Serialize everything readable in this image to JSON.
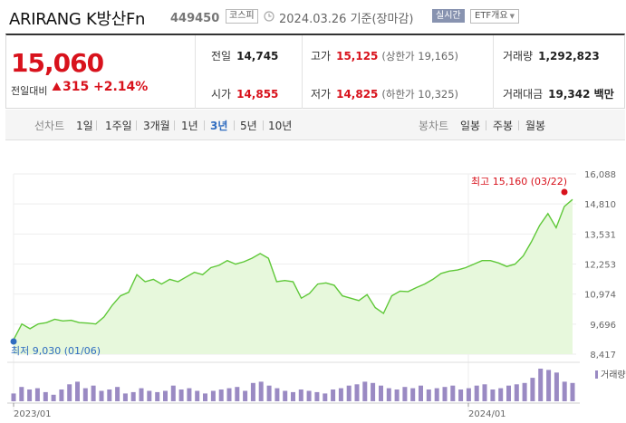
{
  "header": {
    "name": "ARIRANG K방산Fn",
    "code": "449450",
    "market_badge": "코스피",
    "date": "2024.03.26 기준(장마감)",
    "realtime_badge": "실시간",
    "etf_badge": "ETF개요"
  },
  "quote": {
    "price": "15,060",
    "change_label": "전일대비",
    "change": "315",
    "change_pct": "+2.14%",
    "prev_label": "전일",
    "prev": "14,745",
    "high_label": "고가",
    "high": "15,125",
    "upper_limit": "(상한가 19,165)",
    "volume_label": "거래량",
    "volume": "1,292,823",
    "open_label": "시가",
    "open": "14,855",
    "low_label": "저가",
    "low": "14,825",
    "lower_limit": "(하한가 10,325)",
    "amount_label": "거래대금",
    "amount": "19,342 백만"
  },
  "tabs": {
    "line_label": "선차트",
    "line": [
      "1일",
      "1주일",
      "3개월",
      "1년",
      "3년",
      "5년",
      "10년"
    ],
    "active": "3년",
    "candle_label": "봉차트",
    "candle": [
      "일봉",
      "주봉",
      "월봉"
    ]
  },
  "colors": {
    "up": "#d8121c",
    "line": "#5fc838",
    "fill": "#e7f8dc",
    "volume": "#9a8ac3",
    "low": "#2f6cc0",
    "high": "#d8121c"
  },
  "chart_data": {
    "type": "area",
    "price_series": [
      9030,
      9700,
      9500,
      9700,
      9760,
      9900,
      9830,
      9860,
      9760,
      9740,
      9700,
      10000,
      10500,
      10900,
      11050,
      11800,
      11500,
      11600,
      11400,
      11600,
      11500,
      11700,
      11900,
      11800,
      12100,
      12200,
      12400,
      12250,
      12350,
      12500,
      12700,
      12500,
      11500,
      11550,
      11500,
      10800,
      11000,
      11400,
      11450,
      11350,
      10900,
      10800,
      10700,
      10950,
      10400,
      10150,
      10900,
      11100,
      11080,
      11250,
      11400,
      11600,
      11850,
      11950,
      12000,
      12100,
      12250,
      12400,
      12400,
      12300,
      12150,
      12250,
      12600,
      13200,
      13900,
      14400,
      13800,
      14700,
      15000
    ],
    "volume_series": [
      12,
      22,
      18,
      20,
      14,
      10,
      18,
      26,
      30,
      20,
      24,
      16,
      18,
      22,
      12,
      14,
      20,
      16,
      14,
      16,
      24,
      18,
      20,
      16,
      12,
      16,
      18,
      20,
      22,
      16,
      28,
      30,
      24,
      20,
      16,
      14,
      18,
      16,
      14,
      12,
      18,
      20,
      24,
      26,
      30,
      28,
      24,
      20,
      18,
      22,
      20,
      24,
      18,
      20,
      22,
      24,
      18,
      20,
      24,
      26,
      18,
      20,
      24,
      26,
      28,
      36,
      50,
      48,
      44,
      30,
      28
    ],
    "y_ticks": [
      "16,088",
      "14,810",
      "13,531",
      "12,253",
      "10,974",
      "9,696",
      "8,417"
    ],
    "ylim": [
      8417,
      16088
    ],
    "x_ticks": [
      "2023/01",
      "2024/01"
    ],
    "high_label": "최고 15,160 (03/22)",
    "low_label": "최저 9,030 (01/06)",
    "volume_label": "거래량"
  }
}
